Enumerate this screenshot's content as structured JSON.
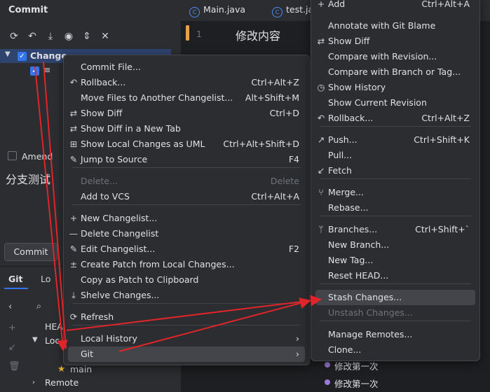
{
  "commit_panel": {
    "title": "Commit",
    "tree_root": "Change",
    "amend_label": "Amend",
    "commit_message": "分支测试",
    "commit_button": "Commit"
  },
  "git_panel": {
    "tab_git": "Git",
    "tab_log": "Lo",
    "head_label": "HEA",
    "local_label": "Loc",
    "main_branch": "main",
    "remote_label": "Remote"
  },
  "editor": {
    "tabs": [
      {
        "label": "Main.java"
      },
      {
        "label": "test.ja"
      }
    ],
    "line_number": "1",
    "code": "修改内容"
  },
  "context_menu": {
    "items": [
      {
        "label": "Commit File...",
        "shortcut": "",
        "icon": "",
        "disabled": false
      },
      {
        "label": "Rollback...",
        "shortcut": "Ctrl+Alt+Z",
        "icon": "rollback-icon",
        "disabled": false
      },
      {
        "label": "Move Files to Another Changelist...",
        "shortcut": "Alt+Shift+M",
        "icon": "",
        "disabled": false
      },
      {
        "label": "Show Diff",
        "shortcut": "Ctrl+D",
        "icon": "diff-icon",
        "disabled": false
      },
      {
        "label": "Show Diff in a New Tab",
        "shortcut": "",
        "icon": "diff-icon",
        "disabled": false
      },
      {
        "label": "Show Local Changes as UML",
        "shortcut": "Ctrl+Alt+Shift+D",
        "icon": "uml-icon",
        "disabled": false
      },
      {
        "label": "Jump to Source",
        "shortcut": "F4",
        "icon": "pencil-icon",
        "disabled": false
      },
      {
        "label": "Delete...",
        "shortcut": "Delete",
        "icon": "",
        "disabled": true
      },
      {
        "label": "Add to VCS",
        "shortcut": "Ctrl+Alt+A",
        "icon": "",
        "disabled": false
      },
      {
        "label": "New Changelist...",
        "shortcut": "",
        "icon": "plus-icon",
        "disabled": false
      },
      {
        "label": "Delete Changelist",
        "shortcut": "",
        "icon": "minus-icon",
        "disabled": false
      },
      {
        "label": "Edit Changelist...",
        "shortcut": "F2",
        "icon": "pencil-icon",
        "disabled": false
      },
      {
        "label": "Create Patch from Local Changes...",
        "shortcut": "",
        "icon": "patch-icon",
        "disabled": false
      },
      {
        "label": "Copy as Patch to Clipboard",
        "shortcut": "",
        "icon": "",
        "disabled": false
      },
      {
        "label": "Shelve Changes...",
        "shortcut": "",
        "icon": "shelve-icon",
        "disabled": false
      },
      {
        "label": "Refresh",
        "shortcut": "",
        "icon": "refresh-icon",
        "disabled": false
      },
      {
        "label": "Local History",
        "shortcut": "",
        "icon": "",
        "disabled": false
      },
      {
        "label": "Git",
        "shortcut": "",
        "icon": "",
        "disabled": false
      }
    ]
  },
  "git_menu": {
    "items": [
      {
        "label": "Add",
        "shortcut": "Ctrl+Alt+A",
        "icon": "plus-icon"
      },
      {
        "label": "Annotate with Git Blame",
        "shortcut": "",
        "icon": ""
      },
      {
        "label": "Show Diff",
        "shortcut": "",
        "icon": "diff-icon"
      },
      {
        "label": "Compare with Revision...",
        "shortcut": "",
        "icon": ""
      },
      {
        "label": "Compare with Branch or Tag...",
        "shortcut": "",
        "icon": ""
      },
      {
        "label": "Show History",
        "shortcut": "",
        "icon": "clock-icon"
      },
      {
        "label": "Show Current Revision",
        "shortcut": "",
        "icon": ""
      },
      {
        "label": "Rollback...",
        "shortcut": "Ctrl+Alt+Z",
        "icon": "rollback-icon"
      },
      {
        "label": "Push...",
        "shortcut": "Ctrl+Shift+K",
        "icon": "push-icon"
      },
      {
        "label": "Pull...",
        "shortcut": "",
        "icon": ""
      },
      {
        "label": "Fetch",
        "shortcut": "",
        "icon": "fetch-icon"
      },
      {
        "label": "Merge...",
        "shortcut": "",
        "icon": "merge-icon"
      },
      {
        "label": "Rebase...",
        "shortcut": "",
        "icon": ""
      },
      {
        "label": "Branches...",
        "shortcut": "Ctrl+Shift+`",
        "icon": "branch-icon"
      },
      {
        "label": "New Branch...",
        "shortcut": "",
        "icon": ""
      },
      {
        "label": "New Tag...",
        "shortcut": "",
        "icon": ""
      },
      {
        "label": "Reset HEAD...",
        "shortcut": "",
        "icon": ""
      },
      {
        "label": "Stash Changes...",
        "shortcut": "",
        "icon": ""
      },
      {
        "label": "Unstash Changes...",
        "shortcut": "",
        "icon": ""
      },
      {
        "label": "Manage Remotes...",
        "shortcut": "",
        "icon": ""
      },
      {
        "label": "Clone...",
        "shortcut": "",
        "icon": ""
      }
    ]
  },
  "graph": {
    "commits": [
      "修改第一次",
      "修改第一次"
    ]
  },
  "colors": {
    "accent": "#3574f0",
    "annotation_arrow": "#e0252a",
    "highlight": "#43454a",
    "commit_dot": "#9b7bd8"
  }
}
